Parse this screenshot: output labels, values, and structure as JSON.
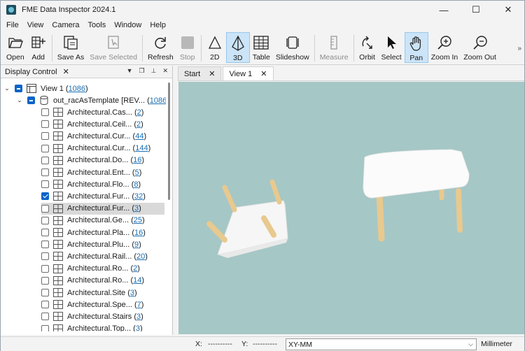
{
  "window": {
    "title": "FME Data Inspector 2024.1",
    "minimize": "—",
    "maximize": "☐",
    "close": "✕"
  },
  "menu": [
    "File",
    "View",
    "Camera",
    "Tools",
    "Window",
    "Help"
  ],
  "toolbar": {
    "open": "Open",
    "add": "Add",
    "save_as": "Save As",
    "save_selected": "Save Selected",
    "refresh": "Refresh",
    "stop": "Stop",
    "view2d": "2D",
    "view3d": "3D",
    "table": "Table",
    "slideshow": "Slideshow",
    "measure": "Measure",
    "orbit": "Orbit",
    "select": "Select",
    "pan": "Pan",
    "zoom_in": "Zoom In",
    "zoom_out": "Zoom Out",
    "more": "»"
  },
  "display_control": {
    "title": "Display Control",
    "close": "✕",
    "view_label": "View 1",
    "view_count": "1086",
    "dataset_label": "out_racAsTemplate [REV...",
    "dataset_count": "1086",
    "items": [
      {
        "label": "Architectural.Cas...",
        "count": "2",
        "checked": false
      },
      {
        "label": "Architectural.Ceil...",
        "count": "2",
        "checked": false
      },
      {
        "label": "Architectural.Cur...",
        "count": "44",
        "checked": false
      },
      {
        "label": "Architectural.Cur...",
        "count": "144",
        "checked": false
      },
      {
        "label": "Architectural.Do...",
        "count": "16",
        "checked": false
      },
      {
        "label": "Architectural.Ent...",
        "count": "5",
        "checked": false
      },
      {
        "label": "Architectural.Flo...",
        "count": "8",
        "checked": false
      },
      {
        "label": "Architectural.Fur...",
        "count": "32",
        "checked": true
      },
      {
        "label": "Architectural.Fur...",
        "count": "3",
        "checked": false,
        "selected": true
      },
      {
        "label": "Architectural.Ge...",
        "count": "25",
        "checked": false
      },
      {
        "label": "Architectural.Pla...",
        "count": "16",
        "checked": false
      },
      {
        "label": "Architectural.Plu...",
        "count": "9",
        "checked": false
      },
      {
        "label": "Architectural.Rail...",
        "count": "20",
        "checked": false
      },
      {
        "label": "Architectural.Ro...",
        "count": "2",
        "checked": false
      },
      {
        "label": "Architectural.Ro...",
        "count": "14",
        "checked": false
      },
      {
        "label": "Architectural.Site",
        "count": "3",
        "checked": false
      },
      {
        "label": "Architectural.Spe...",
        "count": "7",
        "checked": false
      },
      {
        "label": "Architectural.Stairs",
        "count": "3",
        "checked": false
      },
      {
        "label": "Architectural.Top...",
        "count": "3",
        "checked": false
      }
    ]
  },
  "view_tabs": [
    {
      "label": "Start",
      "close": "✕"
    },
    {
      "label": "View 1",
      "close": "✕"
    }
  ],
  "status": {
    "x_label": "X:",
    "x_value": "----------",
    "y_label": "Y:",
    "y_value": "----------",
    "crs": "XY-MM",
    "unit": "Millimeter"
  },
  "colors": {
    "viewport_bg": "#a5c7c6",
    "accent": "#0a64c8",
    "table_top": "#ffffff",
    "table_leg": "#e8c98e"
  }
}
